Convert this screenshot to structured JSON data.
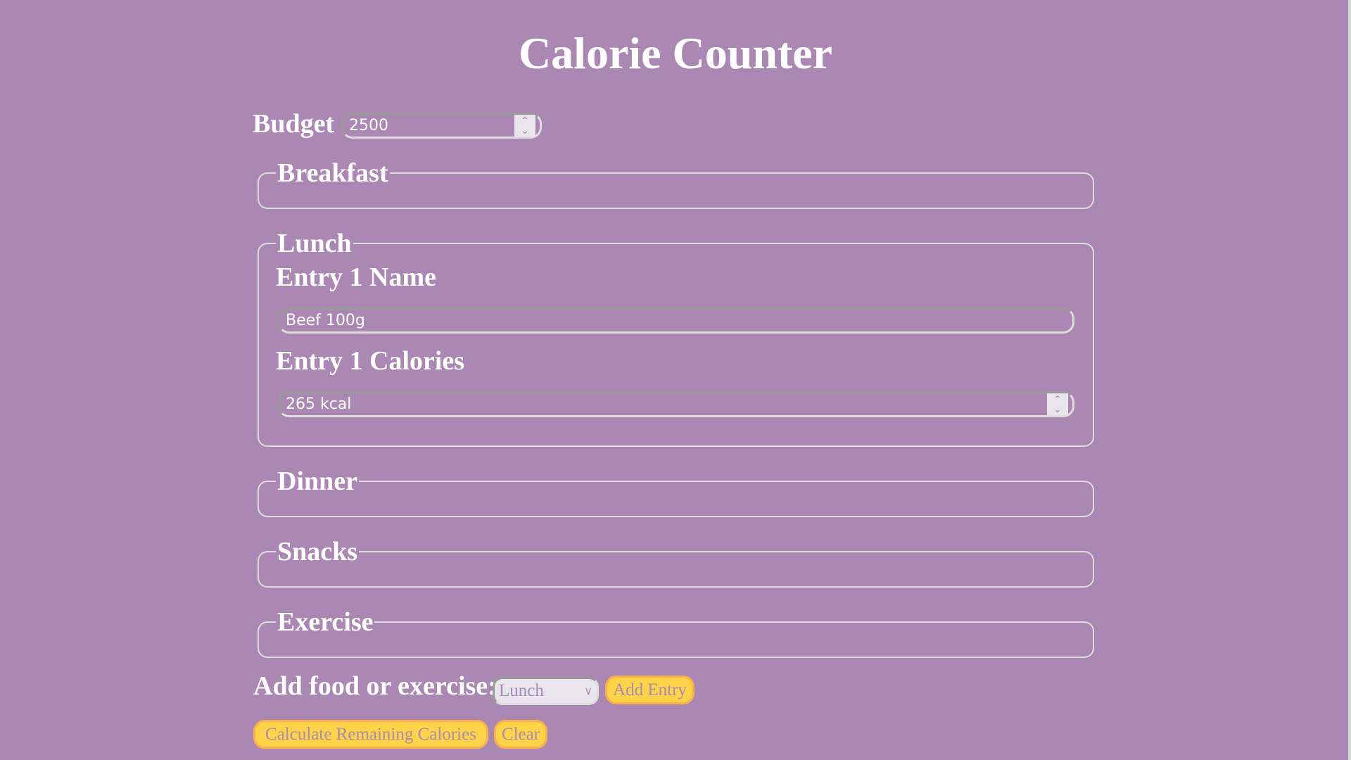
{
  "title": "Calorie Counter",
  "budget": {
    "label": "Budget",
    "value": "2500"
  },
  "sections": {
    "breakfast": "Breakfast",
    "lunch": {
      "legend": "Lunch",
      "entry_name_label": "Entry 1 Name",
      "entry_name_value": "Beef 100g",
      "entry_calories_label": "Entry 1 Calories",
      "entry_calories_value": "265 kcal"
    },
    "dinner": "Dinner",
    "snacks": "Snacks",
    "exercise": "Exercise"
  },
  "add": {
    "label": "Add food or exercise:",
    "selected": "Lunch",
    "button": "Add Entry"
  },
  "actions": {
    "calculate": "Calculate Remaining Calories",
    "clear": "Clear"
  },
  "colors": {
    "background": "#aa88b3",
    "button": "#fed348",
    "button_border": "#fbb14a"
  }
}
